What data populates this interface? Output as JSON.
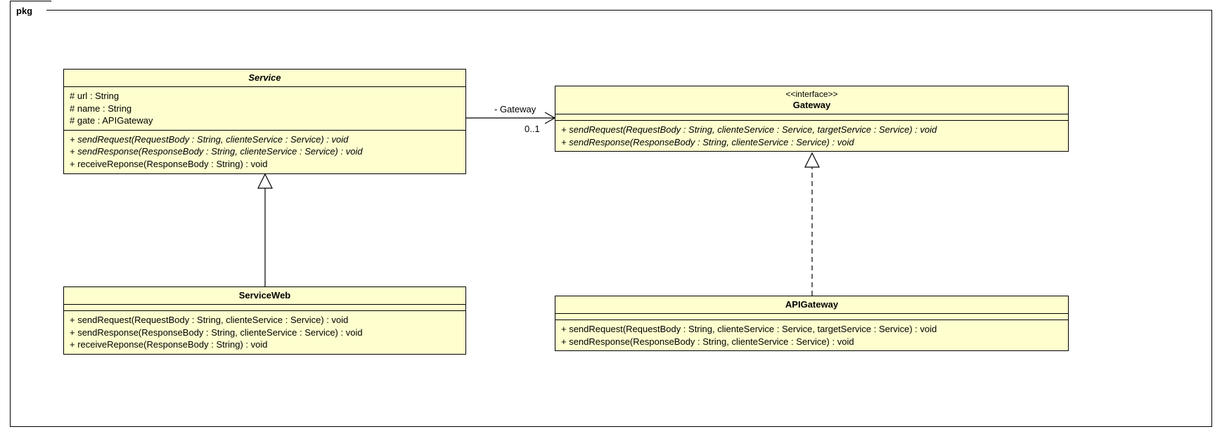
{
  "package": {
    "label": "pkg"
  },
  "classes": {
    "service": {
      "name": "Service",
      "attrs": [
        "# url : String",
        "# name : String",
        "# gate : APIGateway"
      ],
      "ops": [
        "+ sendRequest(RequestBody : String, clienteService : Service) : void",
        "+ sendResponse(ResponseBody : String, clienteService : Service) : void",
        "+ receiveReponse(ResponseBody : String) : void"
      ]
    },
    "serviceWeb": {
      "name": "ServiceWeb",
      "ops": [
        "+ sendRequest(RequestBody : String, clienteService : Service) : void",
        "+ sendResponse(ResponseBody : String, clienteService : Service) : void",
        "+ receiveReponse(ResponseBody : String) : void"
      ]
    },
    "gateway": {
      "stereotype": "<<interface>>",
      "name": "Gateway",
      "ops": [
        "+ sendRequest(RequestBody : String, clienteService : Service, targetService : Service) : void",
        "+ sendResponse(ResponseBody : String, clienteService : Service) : void"
      ]
    },
    "apiGateway": {
      "name": "APIGateway",
      "ops": [
        "+ sendRequest(RequestBody : String, clienteService : Service, targetService : Service) : void",
        "+ sendResponse(ResponseBody : String, clienteService : Service) : void"
      ]
    }
  },
  "assoc": {
    "roleLabel": "- Gateway",
    "multiplicity": "0..1"
  },
  "chart_data": {
    "type": "table",
    "title": "UML Class Diagram — package pkg",
    "nodes": [
      {
        "id": "Service",
        "kind": "abstract class",
        "attributes": [
          "# url : String",
          "# name : String",
          "# gate : APIGateway"
        ],
        "operations": [
          "+ sendRequest(RequestBody : String, clienteService : Service) : void",
          "+ sendResponse(ResponseBody : String, clienteService : Service) : void",
          "+ receiveReponse(ResponseBody : String) : void"
        ]
      },
      {
        "id": "ServiceWeb",
        "kind": "class",
        "attributes": [],
        "operations": [
          "+ sendRequest(RequestBody : String, clienteService : Service) : void",
          "+ sendResponse(ResponseBody : String, clienteService : Service) : void",
          "+ receiveReponse(ResponseBody : String) : void"
        ]
      },
      {
        "id": "Gateway",
        "kind": "interface",
        "attributes": [],
        "operations": [
          "+ sendRequest(RequestBody : String, clienteService : Service, targetService : Service) : void",
          "+ sendResponse(ResponseBody : String, clienteService : Service) : void"
        ]
      },
      {
        "id": "APIGateway",
        "kind": "class",
        "attributes": [],
        "operations": [
          "+ sendRequest(RequestBody : String, clienteService : Service, targetService : Service) : void",
          "+ sendResponse(ResponseBody : String, clienteService : Service) : void"
        ]
      }
    ],
    "edges": [
      {
        "from": "Service",
        "to": "Gateway",
        "type": "association",
        "navigable_to": true,
        "role_to": "- Gateway",
        "multiplicity_to": "0..1"
      },
      {
        "from": "ServiceWeb",
        "to": "Service",
        "type": "generalization"
      },
      {
        "from": "APIGateway",
        "to": "Gateway",
        "type": "realization"
      }
    ]
  }
}
